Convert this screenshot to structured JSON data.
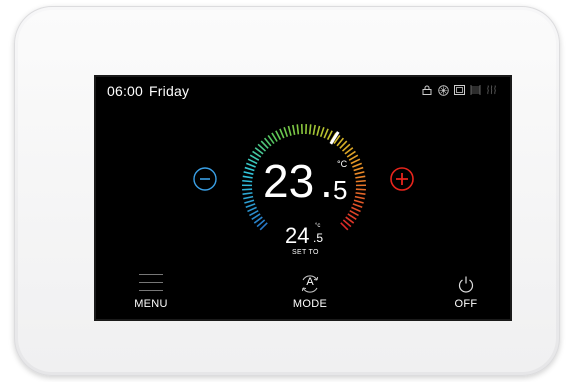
{
  "header": {
    "time": "06:00",
    "day": "Friday",
    "status_icons": [
      "lock-icon",
      "fan-icon",
      "window-icon",
      "radiator-icon",
      "heat-waves-icon"
    ]
  },
  "thermostat": {
    "current_int": "23",
    "current_dec": "5",
    "current_unit": "°C",
    "setpoint_int": "24",
    "setpoint_dec": "5",
    "setpoint_unit": "°c",
    "setpoint_label": "SET TO",
    "minus_symbol": "-",
    "plus_symbol": "+"
  },
  "bottom_bar": {
    "menu_label": "MENU",
    "mode_label": "MODE",
    "mode_icon_letter": "A",
    "off_label": "OFF"
  },
  "colors": {
    "minus": "#3aa0e6",
    "plus": "#e8251c",
    "screen_bg": "#000000"
  }
}
